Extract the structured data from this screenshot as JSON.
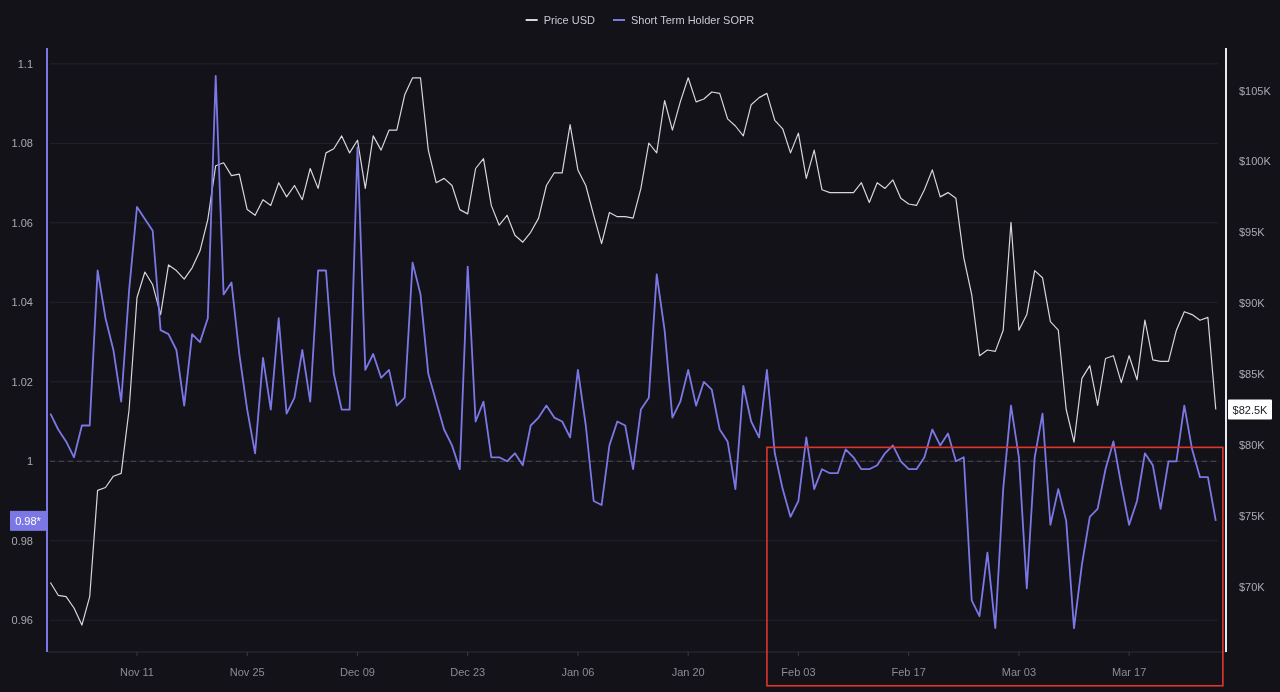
{
  "chart_data": {
    "type": "line",
    "categories": [
      null,
      null,
      null,
      null,
      null,
      null,
      null,
      null,
      null,
      null,
      null,
      "Nov 11",
      null,
      null,
      null,
      null,
      null,
      null,
      null,
      null,
      null,
      null,
      null,
      null,
      null,
      "Nov 25",
      null,
      null,
      null,
      null,
      null,
      null,
      null,
      null,
      null,
      null,
      null,
      null,
      null,
      "Dec 09",
      null,
      null,
      null,
      null,
      null,
      null,
      null,
      null,
      null,
      null,
      null,
      null,
      null,
      "Dec 23",
      null,
      null,
      null,
      null,
      null,
      null,
      null,
      null,
      null,
      null,
      null,
      null,
      null,
      "Jan 06",
      null,
      null,
      null,
      null,
      null,
      null,
      null,
      null,
      null,
      null,
      null,
      null,
      null,
      "Jan 20",
      null,
      null,
      null,
      null,
      null,
      null,
      null,
      null,
      null,
      null,
      null,
      null,
      null,
      "Feb 03",
      null,
      null,
      null,
      null,
      null,
      null,
      null,
      null,
      null,
      null,
      null,
      null,
      null,
      "Feb 17",
      null,
      null,
      null,
      null,
      null,
      null,
      null,
      null,
      null,
      null,
      null,
      null,
      null,
      "Mar 03",
      null,
      null,
      null,
      null,
      null,
      null,
      null,
      null,
      null,
      null,
      null,
      null,
      null,
      "Mar 17",
      null,
      null,
      null,
      null,
      null,
      null,
      null,
      null,
      null,
      null,
      null
    ],
    "series": [
      {
        "name": "Price USD",
        "color": "#d6d6dc",
        "axis": "y2",
        "values": [
          70300,
          69400,
          69300,
          68500,
          67300,
          69300,
          76800,
          77000,
          77800,
          78000,
          82500,
          90400,
          92200,
          91300,
          89200,
          92700,
          92300,
          91700,
          92500,
          93700,
          95900,
          99700,
          99900,
          99000,
          99100,
          96600,
          96200,
          97300,
          96900,
          98500,
          97500,
          98300,
          97300,
          99500,
          98100,
          100600,
          100900,
          101800,
          100600,
          101500,
          98100,
          101800,
          100800,
          102200,
          102200,
          104700,
          105900,
          105900,
          100800,
          98500,
          98800,
          98300,
          96600,
          96300,
          99500,
          100200,
          96900,
          95500,
          96200,
          94800,
          94300,
          95000,
          96000,
          98300,
          99200,
          99200,
          102600,
          99400,
          98300,
          96200,
          94200,
          96400,
          96100,
          96100,
          96000,
          98100,
          101300,
          100600,
          104300,
          102200,
          104200,
          105900,
          104200,
          104400,
          104900,
          104800,
          103000,
          102500,
          101800,
          104000,
          104500,
          104800,
          102900,
          102300,
          100600,
          102000,
          98800,
          100800,
          98000,
          97800,
          97800,
          97800,
          97800,
          98500,
          97100,
          98500,
          98100,
          98700,
          97400,
          97000,
          96900,
          98000,
          99400,
          97500,
          97800,
          97400,
          93200,
          90600,
          86300,
          86700,
          86600,
          88100,
          95700,
          88100,
          89200,
          92300,
          91800,
          88700,
          88100,
          82500,
          80200,
          84700,
          85600,
          82800,
          86100,
          86300,
          84400,
          86300,
          84600,
          88800,
          86000,
          85900,
          85900,
          88100,
          89400,
          89200,
          88800,
          89000,
          82500
        ]
      },
      {
        "name": "Short Term Holder SOPR",
        "color": "#7b78e6",
        "values": [
          1.012,
          1.008,
          1.005,
          1.001,
          1.009,
          1.009,
          1.048,
          1.036,
          1.028,
          1.015,
          1.043,
          1.064,
          1.061,
          1.058,
          1.033,
          1.032,
          1.028,
          1.014,
          1.032,
          1.03,
          1.036,
          1.097,
          1.042,
          1.045,
          1.027,
          1.013,
          1.002,
          1.026,
          1.013,
          1.036,
          1.012,
          1.016,
          1.028,
          1.015,
          1.048,
          1.048,
          1.022,
          1.013,
          1.013,
          1.079,
          1.023,
          1.027,
          1.021,
          1.023,
          1.014,
          1.016,
          1.05,
          1.042,
          1.022,
          1.015,
          1.008,
          1.004,
          0.998,
          1.049,
          1.01,
          1.015,
          1.001,
          1.001,
          1.0,
          1.002,
          0.999,
          1.009,
          1.011,
          1.014,
          1.011,
          1.01,
          1.006,
          1.023,
          1.009,
          0.99,
          0.989,
          1.004,
          1.01,
          1.009,
          0.998,
          1.013,
          1.016,
          1.047,
          1.033,
          1.011,
          1.015,
          1.023,
          1.014,
          1.02,
          1.018,
          1.008,
          1.005,
          0.993,
          1.019,
          1.01,
          1.006,
          1.023,
          1.002,
          0.993,
          0.986,
          0.99,
          1.006,
          0.993,
          0.998,
          0.997,
          0.997,
          1.003,
          1.001,
          0.998,
          0.998,
          0.999,
          1.002,
          1.004,
          1.0,
          0.998,
          0.998,
          1.001,
          1.008,
          1.004,
          1.007,
          1.0,
          1.001,
          0.965,
          0.961,
          0.977,
          0.958,
          0.993,
          1.014,
          1.001,
          0.968,
          1.001,
          1.012,
          0.984,
          0.993,
          0.985,
          0.958,
          0.974,
          0.986,
          0.988,
          0.998,
          1.005,
          0.994,
          0.984,
          0.99,
          1.002,
          0.999,
          0.988,
          1.0,
          1.0,
          1.014,
          1.003,
          0.996,
          0.996,
          0.985
        ]
      }
    ],
    "ylim": [
      0.952,
      1.104
    ],
    "yticks": [
      0.96,
      0.98,
      1,
      1.02,
      1.04,
      1.06,
      1.08,
      1.1
    ],
    "y2lim": [
      65400,
      108000
    ],
    "y2ticks": [
      {
        "value": 70000,
        "label": "$70K"
      },
      {
        "value": 75000,
        "label": "$75K"
      },
      {
        "value": 80000,
        "label": "$80K"
      },
      {
        "value": 85000,
        "label": "$85K"
      },
      {
        "value": 90000,
        "label": "$90K"
      },
      {
        "value": 95000,
        "label": "$95K"
      },
      {
        "value": 100000,
        "label": "$100K"
      },
      {
        "value": 105000,
        "label": "$105K"
      }
    ],
    "ref_lines": [
      {
        "axis": "y",
        "value": 1
      }
    ],
    "grid": true,
    "legend": "top"
  },
  "last_value_tags": [
    "$82.5K",
    "0.98*"
  ],
  "highlight_box": {
    "color": "#e0362c"
  }
}
